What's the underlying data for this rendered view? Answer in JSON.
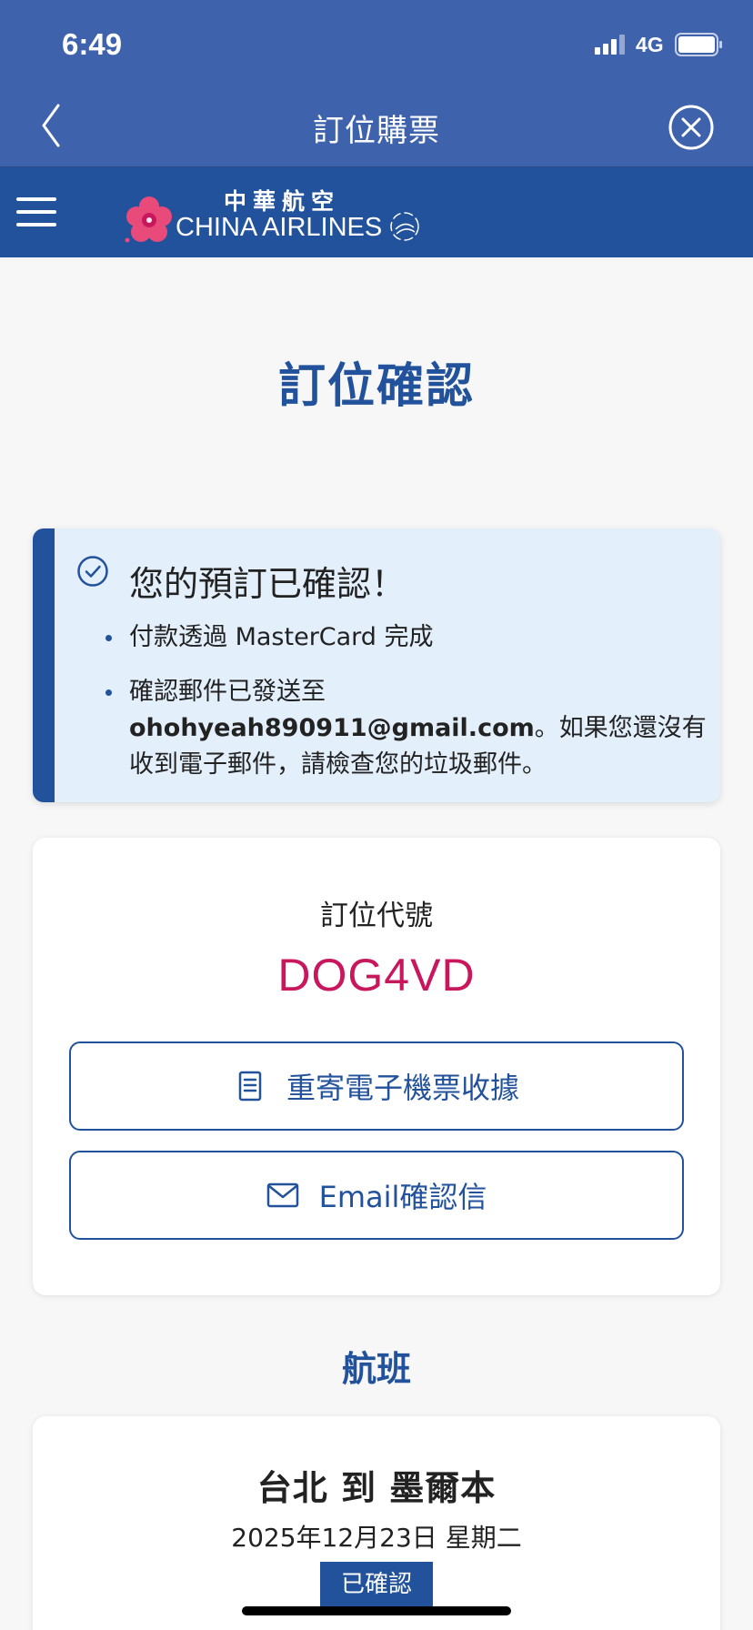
{
  "status_bar": {
    "time": "6:49",
    "network": "4G"
  },
  "nav": {
    "title": "訂位購票"
  },
  "brand": {
    "name_cn": "中華航空",
    "name_en": "CHINA AIRLINES"
  },
  "page": {
    "title": "訂位確認"
  },
  "confirmation": {
    "heading": "您的預訂已確認！",
    "payment_note": "付款透過 MasterCard 完成",
    "email_prefix": "確認郵件已發送至",
    "email": "ohohyeah890911@gmail.com",
    "email_suffix": "。如果您還沒有收到電子郵件，請檢查您的垃圾郵件。"
  },
  "booking": {
    "pnr_label": "訂位代號",
    "pnr_code": "DOG4VD",
    "resend_button": "重寄電子機票收據",
    "email_button": "Email確認信"
  },
  "flights": {
    "section_title": "航班",
    "route": "台北 到 墨爾本",
    "date": "2025年12月23日 星期二",
    "status": "已確認"
  },
  "colors": {
    "header": "#3f62ad",
    "brand_bar": "#22529c",
    "accent": "#22529c",
    "pnr": "#c8175d",
    "confirm_bg": "#e3effb"
  },
  "icons": [
    "back-chevron-icon",
    "close-circle-icon",
    "hamburger-menu-icon",
    "plum-blossom-logo-icon",
    "check-circle-icon",
    "document-icon",
    "envelope-icon"
  ]
}
